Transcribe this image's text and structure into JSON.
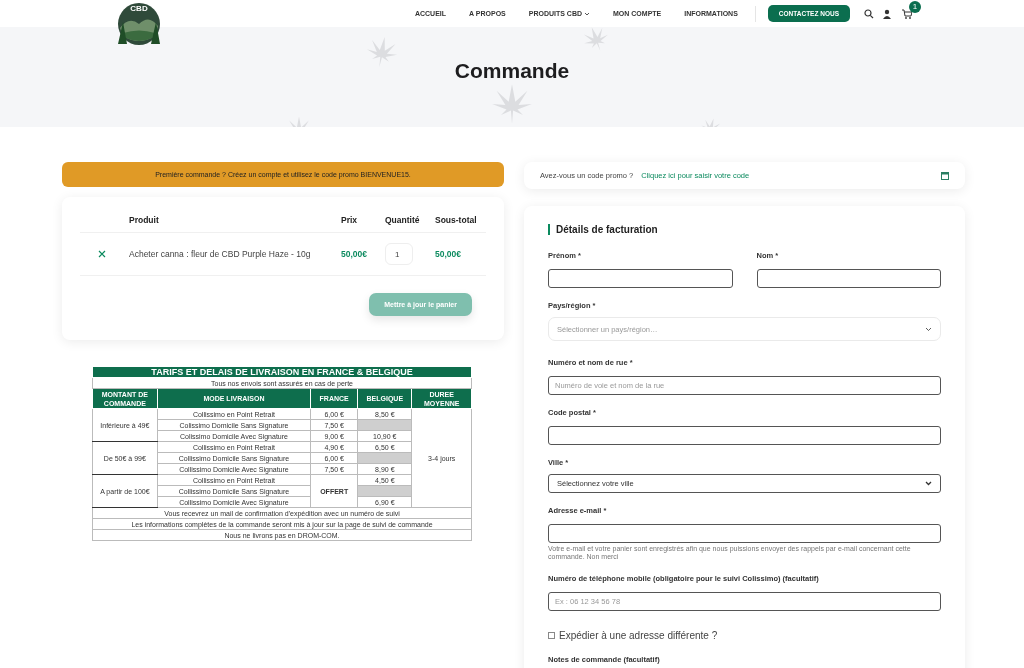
{
  "header": {
    "logo_text": "CBD",
    "nav": [
      {
        "label": "ACCUEIL",
        "has_dropdown": false
      },
      {
        "label": "A PROPOS",
        "has_dropdown": false
      },
      {
        "label": "PRODUITS CBD",
        "has_dropdown": true
      },
      {
        "label": "MON COMPTE",
        "has_dropdown": false
      },
      {
        "label": "INFORMATIONS",
        "has_dropdown": false
      }
    ],
    "contact_button": "CONTACTEZ NOUS",
    "cart_count": "1"
  },
  "page_title": "Commande",
  "promo_banner": "Première commande ? Créez un compte et utilisez le code promo BIENVENUE15.",
  "cart": {
    "columns": [
      "Produit",
      "Prix",
      "Quantité",
      "Sous-total"
    ],
    "rows": [
      {
        "product": "Acheter canna : fleur de CBD Purple Haze - 10g",
        "price": "50,00€",
        "quantity": "1",
        "subtotal": "50,00€"
      }
    ],
    "update_button": {
      "label": "Mettre à jour le panier",
      "disabled": true
    }
  },
  "delivery_table": {
    "title": "TARIFS ET DELAIS DE LIVRAISON EN FRANCE & BELGIQUE",
    "subtitle": "Tous nos envois sont assurés en cas de perte",
    "columns": [
      "MONTANT DE COMMANDE",
      "MODE LIVRAISON",
      "FRANCE",
      "BELGIQUE",
      "DUREE MOYENNE"
    ],
    "duration": "3-4 jours",
    "groups": [
      {
        "amount": "Inférieure à 49€",
        "rows": [
          {
            "mode": "Collissimo en Point Retrait",
            "france": "6,00 €",
            "belgique": "8,50 €"
          },
          {
            "mode": "Colissimo Domicile Sans Signature",
            "france": "7,50 €"
          },
          {
            "mode": "Colissimo Domicile Avec Signature",
            "france": "9,00 €",
            "belgique": "10,90 €"
          }
        ]
      },
      {
        "amount": "De 50€ à 99€",
        "rows": [
          {
            "mode": "Collissimo en Point Retrait",
            "france": "4,90 €",
            "belgique": "6,50 €"
          },
          {
            "mode": "Collissimo Domicile Sans Signature",
            "france": "6,00 €"
          },
          {
            "mode": "Collissimo Domicile Avec Signature",
            "france": "7,50 €",
            "belgique": "8,90 €"
          }
        ]
      },
      {
        "amount": "A partir de 100€",
        "france": "OFFERT",
        "rows": [
          {
            "mode": "Collissimo en Point Retrait",
            "belgique": "4,50 €"
          },
          {
            "mode": "Collissimo Domicile Sans Signature"
          },
          {
            "mode": "Collissimo Domicile Avec Signature",
            "belgique": "6,90 €"
          }
        ]
      }
    ],
    "notes": [
      "Vous recevrez un mail de confirmation d'expédition avec un numéro de suivi",
      "Les informations complètes de la commande seront mis à jour sur la page de suivi de commande",
      "Nous ne livrons pas en DROM-COM."
    ]
  },
  "coupon": {
    "text": "Avez-vous un code promo ?",
    "link": "Cliquez ici pour saisir votre code"
  },
  "billing": {
    "title": "Détails de facturation",
    "name_fields": [
      {
        "label": "Prénom *"
      },
      {
        "label": "Nom *"
      }
    ],
    "fields": [
      {
        "kind": "select-soft",
        "label": "Pays/région *",
        "placeholder": "Sélectionner un pays/région…"
      },
      {
        "kind": "input",
        "label": "Numéro et nom de rue *",
        "placeholder": "Numéro de voie et nom de la rue"
      },
      {
        "kind": "input",
        "label": "Code postal *"
      },
      {
        "kind": "select",
        "label": "Ville *",
        "value": "Sélectionnez votre ville"
      },
      {
        "kind": "input",
        "label": "Adresse e-mail *",
        "note": "Votre e-mail et votre panier sont enregistrés afin que nous puissions envoyer des rappels par e-mail concernant cette commande. Non merci"
      },
      {
        "kind": "input",
        "label": "Numéro de téléphone mobile (obligatoire pour le suivi Colissimo) (facultatif)",
        "placeholder": "Ex : 06 12 34 56 78"
      }
    ],
    "ship_elsewhere": {
      "label": "Expédier à une adresse différente ?",
      "checked": false
    },
    "notes_label": "Notes de commande (facultatif)"
  }
}
